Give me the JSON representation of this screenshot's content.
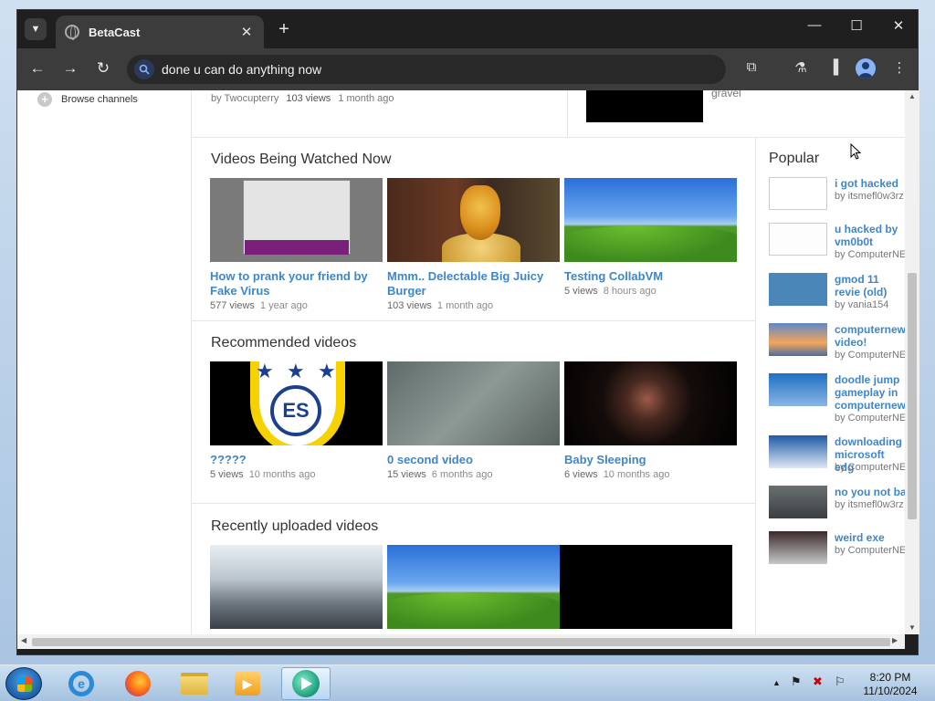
{
  "browser": {
    "tab_title": "BetaCast",
    "tab_close": "✕",
    "new_tab": "+",
    "address": "done u can do anything now"
  },
  "left_nav": {
    "browse_channels": "Browse channels"
  },
  "top_partial": {
    "by": "by Twocupterry",
    "views": "103 views",
    "ago": "1 month ago",
    "right_title": "gravel"
  },
  "sections": {
    "watched_now": {
      "title": "Videos Being Watched Now",
      "videos": [
        {
          "title": "How to prank your friend by Fake Virus",
          "views": "577 views",
          "ago": "1 year ago"
        },
        {
          "title": "Mmm.. Delectable Big Juicy Burger",
          "views": "103 views",
          "ago": "1 month ago"
        },
        {
          "title": "Testing CollabVM",
          "views": "5 views",
          "ago": "8 hours ago"
        }
      ]
    },
    "recommended": {
      "title": "Recommended videos",
      "videos": [
        {
          "title": "?????",
          "views": "5 views",
          "ago": "10 months ago"
        },
        {
          "title": "0 second video",
          "views": "15 views",
          "ago": "6 months ago"
        },
        {
          "title": "Baby Sleeping",
          "views": "6 views",
          "ago": "10 months ago"
        }
      ]
    },
    "recent": {
      "title": "Recently uploaded videos"
    }
  },
  "popular": {
    "title": "Popular",
    "items": [
      {
        "title": "i got hacked",
        "by": "by itsmefl0w3rz"
      },
      {
        "title": "u hacked by vm0b0t",
        "by": "by ComputerNE"
      },
      {
        "title": "gmod 11 revie (old)",
        "by": "by vania154"
      },
      {
        "title": "computernew video!",
        "by": "by ComputerNE"
      },
      {
        "title": "doodle jump gameplay in computernew",
        "by": "by ComputerNE"
      },
      {
        "title": "downloading microsoft edg",
        "by": "by ComputerNE"
      },
      {
        "title": "no you not ba",
        "by": "by itsmefl0w3rz"
      },
      {
        "title": "weird exe",
        "by": "by ComputerNE"
      }
    ]
  },
  "taskbar": {
    "time": "8:20 PM",
    "date": "11/10/2024"
  },
  "colors": {
    "link": "#3f86c8",
    "chrome_dark": "#1f1f1f",
    "toolbar": "#3c3c3c"
  }
}
